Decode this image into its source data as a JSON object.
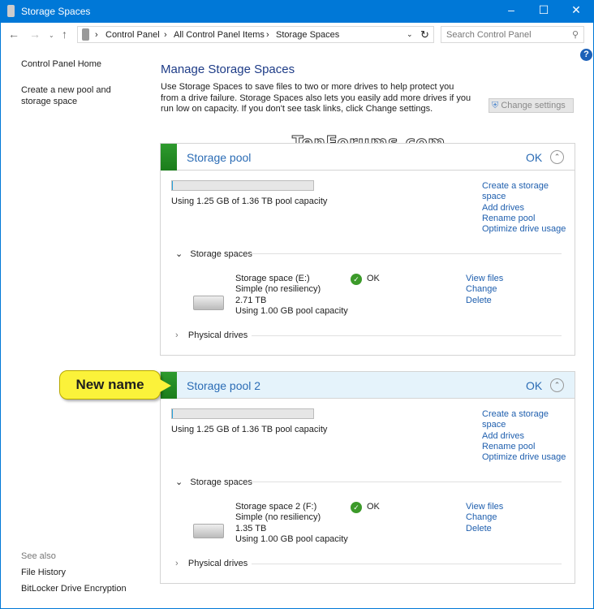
{
  "window": {
    "title": "Storage Spaces"
  },
  "address": {
    "crumbs": [
      "Control Panel",
      "All Control Panel Items",
      "Storage Spaces"
    ],
    "search_placeholder": "Search Control Panel"
  },
  "left": {
    "home": "Control Panel Home",
    "create": "Create a new pool and storage space",
    "see_also": "See also",
    "file_history": "File History",
    "bitlocker": "BitLocker Drive Encryption"
  },
  "main": {
    "title": "Manage Storage Spaces",
    "description": "Use Storage Spaces to save files to two or more drives to help protect you from a drive failure. Storage Spaces also lets you easily add more drives if you run low on capacity. If you don't see task links, click Change settings.",
    "change_settings": "Change settings"
  },
  "watermark": "TenForums.com",
  "callout": "New name",
  "pools": [
    {
      "name": "Storage pool",
      "status": "OK",
      "usage_fraction": 0.0009,
      "usage_text": "Using 1.25 GB of 1.36 TB pool capacity",
      "links": [
        "Create a storage space",
        "Add drives",
        "Rename pool",
        "Optimize drive usage"
      ],
      "spaces_label": "Storage spaces",
      "physical_label": "Physical drives",
      "space": {
        "name": "Storage space (E:)",
        "resiliency": "Simple (no resiliency)",
        "size": "2.71 TB",
        "usage": "Using 1.00 GB pool capacity",
        "status": "OK",
        "links": [
          "View files",
          "Change",
          "Delete"
        ]
      },
      "highlighted": false
    },
    {
      "name": "Storage pool 2",
      "status": "OK",
      "usage_fraction": 0.0009,
      "usage_text": "Using 1.25 GB of 1.36 TB pool capacity",
      "links": [
        "Create a storage space",
        "Add drives",
        "Rename pool",
        "Optimize drive usage"
      ],
      "spaces_label": "Storage spaces",
      "physical_label": "Physical drives",
      "space": {
        "name": "Storage space 2 (F:)",
        "resiliency": "Simple (no resiliency)",
        "size": "1.35 TB",
        "usage": "Using 1.00 GB pool capacity",
        "status": "OK",
        "links": [
          "View files",
          "Change",
          "Delete"
        ]
      },
      "highlighted": true
    }
  ],
  "colors": {
    "titlebar": "#0078d7",
    "link": "#1f5fae",
    "pool_ok": "#1b7d1b",
    "highlight": "#e5f3fb",
    "callout": "#fbf23a"
  }
}
